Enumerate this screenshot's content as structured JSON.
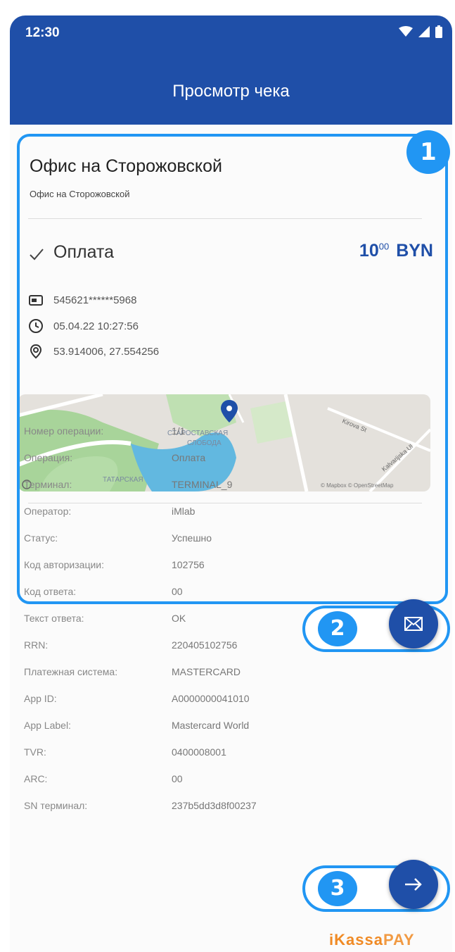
{
  "status": {
    "time": "12:30"
  },
  "appbar": {
    "title": "Просмотр чека"
  },
  "merchant": {
    "name": "Офис на Сторожовской",
    "subtitle": "Офис на Сторожовской"
  },
  "operation": {
    "type": "Оплата",
    "amount_int": "10",
    "amount_frac": "00",
    "currency": "BYN"
  },
  "info": {
    "card": "545621******5968",
    "datetime": "05.04.22  10:27:56",
    "coords": "53.914006, 27.554256"
  },
  "map": {
    "district_1": "СТАРОСТАВСКАЯ",
    "district_1b": "СЛОБОДА",
    "district_2": "ТАТАРСКАЯ",
    "street_1": "Kirova St",
    "street_2": "Kalvarijska Ul",
    "copyright": "© Mapbox © OpenStreetMap"
  },
  "details": [
    {
      "label": "Номер операции:",
      "value": "1/1"
    },
    {
      "label": "Операция:",
      "value": "Оплата"
    },
    {
      "label": "Терминал:",
      "value": "TERMINAL_9"
    },
    {
      "label": "Оператор:",
      "value": "iMlab"
    },
    {
      "label": "Статус:",
      "value": "Успешно"
    },
    {
      "label": "Код авторизации:",
      "value": "102756"
    },
    {
      "label": "Код ответа:",
      "value": "00"
    },
    {
      "label": "Текст ответа:",
      "value": "OK"
    },
    {
      "label": "RRN:",
      "value": "220405102756"
    },
    {
      "label": "Платежная система:",
      "value": "MASTERCARD"
    },
    {
      "label": "App ID:",
      "value": "A0000000041010"
    },
    {
      "label": "App Label:",
      "value": "Mastercard World"
    },
    {
      "label": "TVR:",
      "value": "0400008001"
    },
    {
      "label": "ARC:",
      "value": "00"
    },
    {
      "label": "SN терминал:",
      "value": "237b5dd3d8f00237"
    }
  ],
  "annotations": {
    "badge1": "1",
    "badge2": "2",
    "badge3": "3"
  },
  "brand": {
    "part1": "iKassa",
    "part2": "PAY"
  },
  "colors": {
    "appbar": "#1f4fa8",
    "highlight": "#2196f3",
    "amount": "#1f4fa8",
    "brand": "#f08a24"
  }
}
